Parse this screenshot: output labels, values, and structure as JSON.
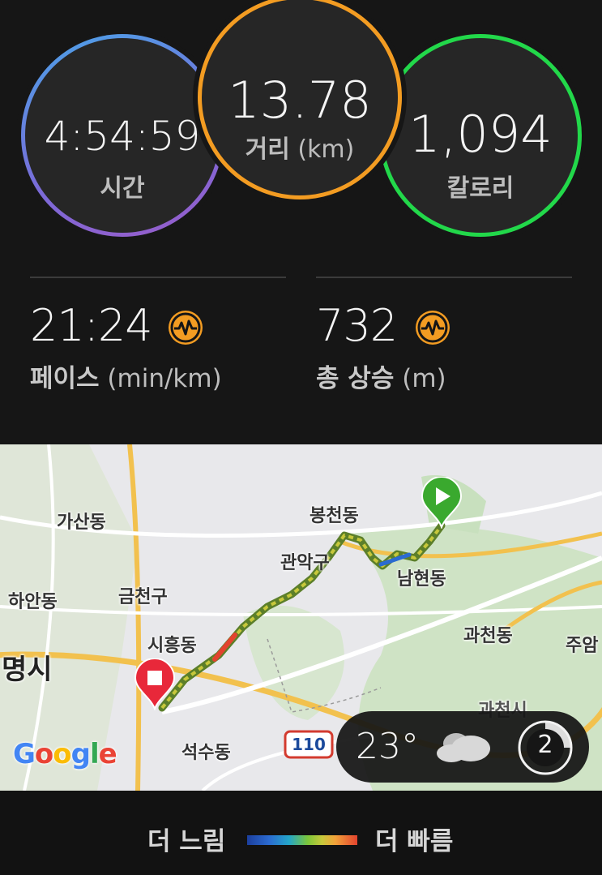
{
  "stats": {
    "time": {
      "value": "4:54:59",
      "label": "시간"
    },
    "distance": {
      "value": "13.78",
      "label": "거리",
      "unit": "(km)"
    },
    "calories": {
      "value": "1,094",
      "label": "칼로리"
    },
    "pace": {
      "value": "21:24",
      "label": "페이스",
      "unit": "(min/km)",
      "icon": "heart-rate-wave-icon"
    },
    "ascent": {
      "value": "732",
      "label": "총 상승",
      "unit": "(m)",
      "icon": "heart-rate-wave-icon"
    }
  },
  "colors": {
    "time_ring": "#4aa3e8",
    "distance_ring": "#f39c22",
    "calories_ring": "#22d84a",
    "accent_badge": "#f39c22",
    "start_marker": "#3aa92e",
    "end_marker": "#e8283a"
  },
  "map": {
    "labels": {
      "gasan": "가산동",
      "bongcheon": "봉천동",
      "gwanak": "관악구",
      "namhyeon": "남현동",
      "haan": "하안동",
      "geumcheon": "금천구",
      "siheung": "시흥동",
      "gwacheon_dong": "과천동",
      "juam": "주암",
      "gwangmyeong": "명시",
      "seoksu": "석수동",
      "gwacheon_si": "과천시",
      "highway": "110"
    },
    "logo": "Google",
    "start_icon": "play-pin-icon",
    "end_icon": "stop-pin-icon"
  },
  "weather": {
    "temperature": "23°",
    "icon": "cloudy-icon",
    "wind_speed": "2",
    "wind_icon": "wind-direction-icon"
  },
  "legend": {
    "slow_label": "더 느림",
    "fast_label": "더 빠름"
  }
}
